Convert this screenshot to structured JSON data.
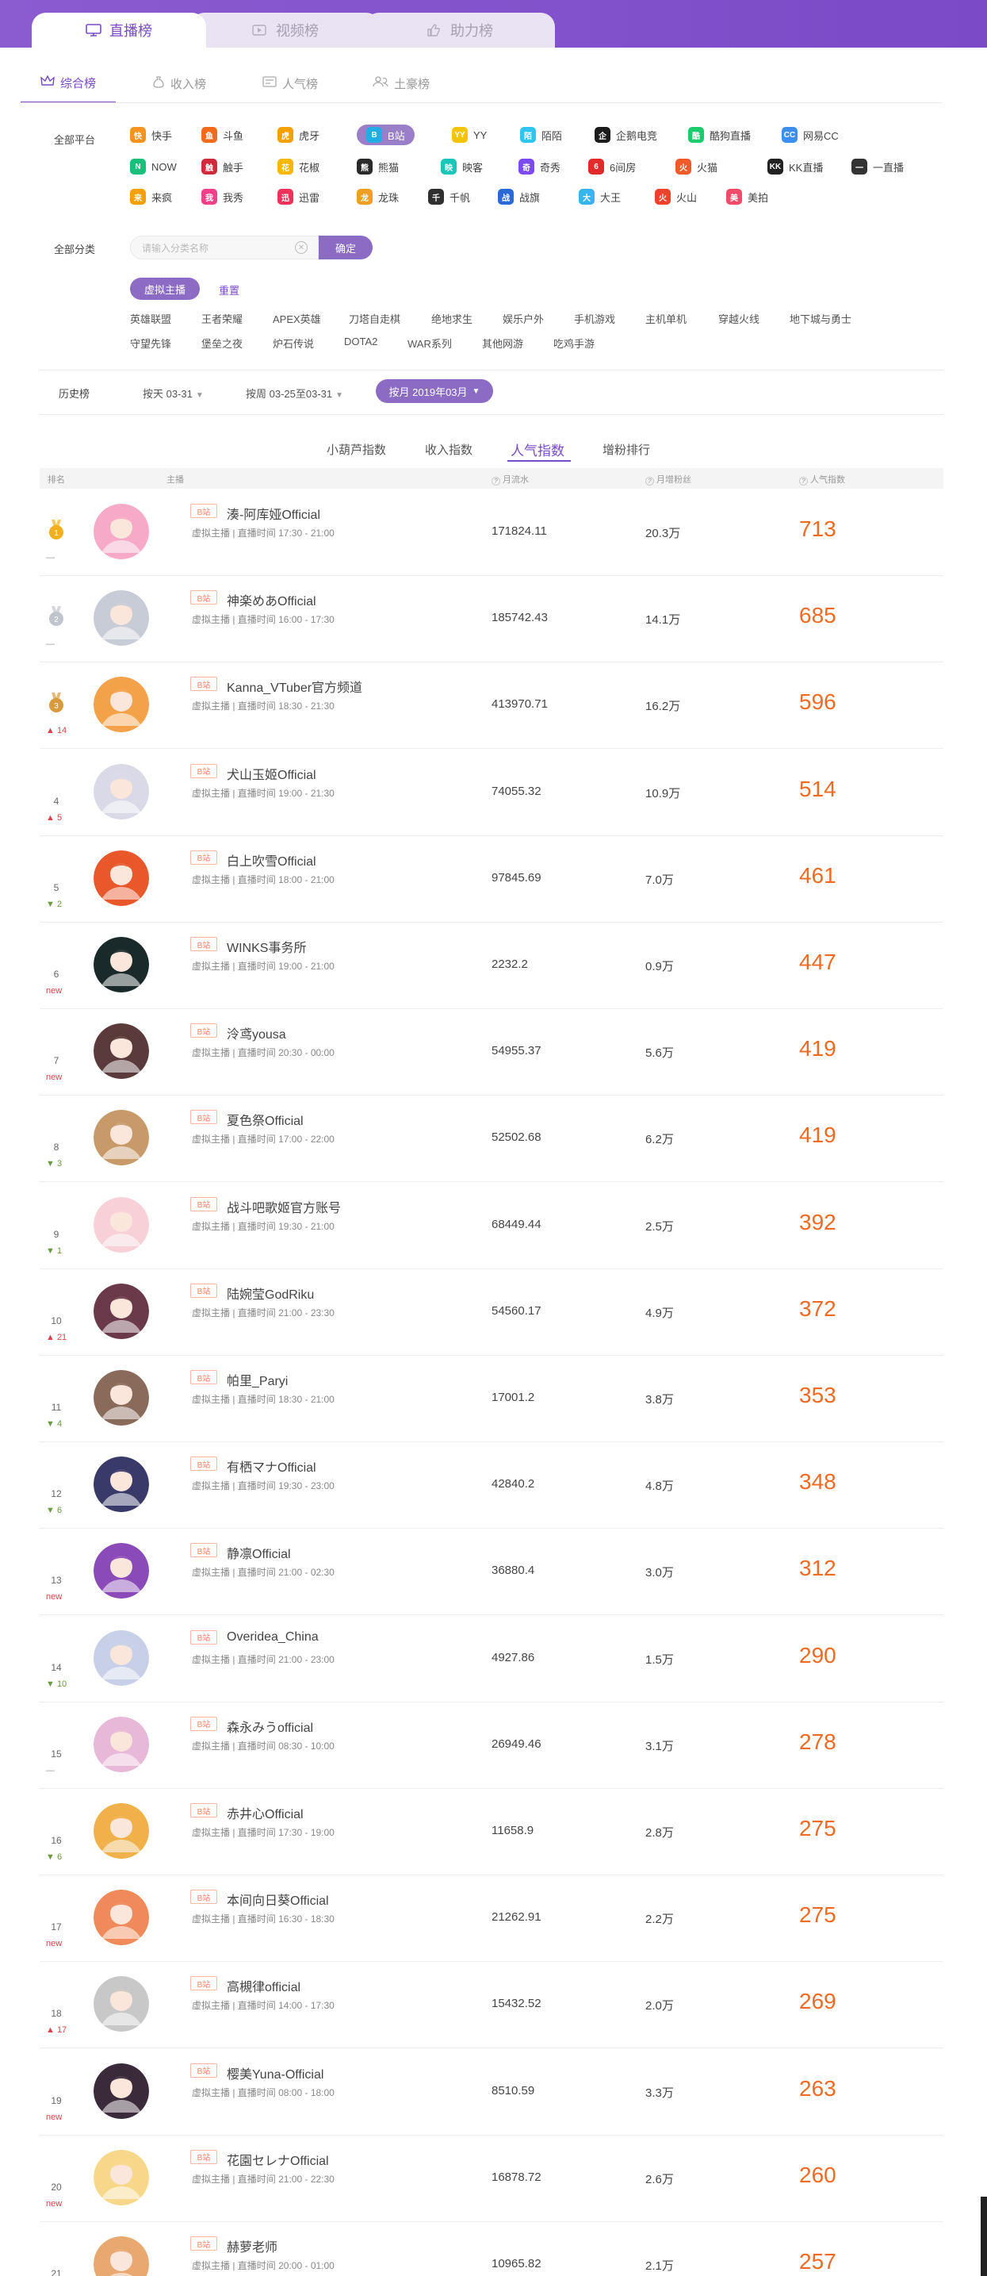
{
  "main_tabs": [
    {
      "label": "直播榜",
      "icon": "monitor-icon"
    },
    {
      "label": "视频榜",
      "icon": "video-icon"
    },
    {
      "label": "助力榜",
      "icon": "thumbs-up-icon"
    }
  ],
  "sub_tabs": [
    {
      "label": "综合榜",
      "icon": "crown-icon"
    },
    {
      "label": "收入榜",
      "icon": "money-bag-icon"
    },
    {
      "label": "人气榜",
      "icon": "card-icon"
    },
    {
      "label": "土豪榜",
      "icon": "users-icon"
    }
  ],
  "platform_filter": {
    "label": "全部平台",
    "items": [
      {
        "label": "快手",
        "color": "#f7931e",
        "glyph": "快"
      },
      {
        "label": "斗鱼",
        "color": "#f26a1b",
        "glyph": "鱼"
      },
      {
        "label": "虎牙",
        "color": "#f6a000",
        "glyph": "虎"
      },
      {
        "label": "B站",
        "color": "#23ade5",
        "glyph": "B",
        "selected": true
      },
      {
        "label": "YY",
        "color": "#f5c400",
        "glyph": "YY"
      },
      {
        "label": "陌陌",
        "color": "#2ec5f0",
        "glyph": "陌"
      },
      {
        "label": "企鹅电竞",
        "color": "#1c1c1c",
        "glyph": "企"
      },
      {
        "label": "酷狗直播",
        "color": "#1ccb6c",
        "glyph": "酷"
      },
      {
        "label": "网易CC",
        "color": "#3c8ef0",
        "glyph": "CC"
      },
      {
        "label": "NOW",
        "color": "#18c07a",
        "glyph": "N"
      },
      {
        "label": "触手",
        "color": "#d02a3c",
        "glyph": "触"
      },
      {
        "label": "花椒",
        "color": "#f9b800",
        "glyph": "花"
      },
      {
        "label": "熊猫",
        "color": "#2a2a2a",
        "glyph": "熊"
      },
      {
        "label": "映客",
        "color": "#19c7b8",
        "glyph": "映"
      },
      {
        "label": "奇秀",
        "color": "#7b4af0",
        "glyph": "奇"
      },
      {
        "label": "6间房",
        "color": "#e22a2a",
        "glyph": "6"
      },
      {
        "label": "火猫",
        "color": "#f05a28",
        "glyph": "火"
      },
      {
        "label": "KK直播",
        "color": "#222222",
        "glyph": "KK"
      },
      {
        "label": "一直播",
        "color": "#333333",
        "glyph": "一"
      },
      {
        "label": "来疯",
        "color": "#f6a000",
        "glyph": "来"
      },
      {
        "label": "我秀",
        "color": "#f43f8a",
        "glyph": "我"
      },
      {
        "label": "迅雷",
        "color": "#f0325a",
        "glyph": "迅"
      },
      {
        "label": "龙珠",
        "color": "#f0a020",
        "glyph": "龙"
      },
      {
        "label": "千帆",
        "color": "#303030",
        "glyph": "千"
      },
      {
        "label": "战旗",
        "color": "#2a6ad8",
        "glyph": "战"
      },
      {
        "label": "大王",
        "color": "#38b4f0",
        "glyph": "大"
      },
      {
        "label": "火山",
        "color": "#f0402a",
        "glyph": "火"
      },
      {
        "label": "美拍",
        "color": "#f24a6a",
        "glyph": "美"
      }
    ]
  },
  "category_filter": {
    "label": "全部分类",
    "placeholder": "请输入分类名称",
    "confirm_label": "确定",
    "selected_chip": "虚拟主播",
    "reset_label": "重置",
    "categories_row1": [
      "英雄联盟",
      "王者荣耀",
      "APEX英雄",
      "刀塔自走棋",
      "绝地求生",
      "娱乐户外",
      "手机游戏",
      "主机单机",
      "穿越火线",
      "地下城与勇士"
    ],
    "categories_row2": [
      "守望先锋",
      "堡垒之夜",
      "炉石传说",
      "DOTA2",
      "WAR系列",
      "其他网游",
      "吃鸡手游"
    ]
  },
  "history": {
    "label": "历史榜",
    "by_day": "按天 03-31",
    "by_week": "按周 03-25至03-31",
    "by_month": "按月 2019年03月"
  },
  "index_tabs": [
    "小葫芦指数",
    "收入指数",
    "人气指数",
    "增粉排行"
  ],
  "table": {
    "headers": {
      "rank": "排名",
      "streamer": "主播",
      "flow": "月流水",
      "fans": "月增粉丝",
      "index": "人气指数"
    },
    "rows": [
      {
        "rank": "1",
        "medal": "gold",
        "change": "—",
        "dir": "same",
        "name": "湊-阿库娅Official",
        "meta": "虚拟主播 | 直播时间 17:30 - 21:00",
        "flow": "171824.11",
        "fans": "20.3万",
        "index": "713",
        "avatar": "#f7a9c8"
      },
      {
        "rank": "2",
        "medal": "silver",
        "change": "—",
        "dir": "same",
        "name": "神楽めあOfficial",
        "meta": "虚拟主播 | 直播时间 16:00 - 17:30",
        "flow": "185742.43",
        "fans": "14.1万",
        "index": "685",
        "avatar": "#c8ccd6"
      },
      {
        "rank": "3",
        "medal": "bronze",
        "change": "▲ 14",
        "dir": "up",
        "name": "Kanna_VTuber官方频道",
        "meta": "虚拟主播 | 直播时间 18:30 - 21:30",
        "flow": "413970.71",
        "fans": "16.2万",
        "index": "596",
        "avatar": "#f3a24a"
      },
      {
        "rank": "4",
        "change": "▲ 5",
        "dir": "up",
        "name": "犬山玉姬Official",
        "meta": "虚拟主播 | 直播时间 19:00 - 21:30",
        "flow": "74055.32",
        "fans": "10.9万",
        "index": "514",
        "avatar": "#d9d9e8"
      },
      {
        "rank": "5",
        "change": "▼ 2",
        "dir": "down",
        "name": "白上吹雪Official",
        "meta": "虚拟主播 | 直播时间 18:00 - 21:00",
        "flow": "97845.69",
        "fans": "7.0万",
        "index": "461",
        "avatar": "#e8582a"
      },
      {
        "rank": "6",
        "change": "new",
        "dir": "new",
        "name": "WINKS事务所",
        "meta": "虚拟主播 | 直播时间 19:00 - 21:00",
        "flow": "2232.2",
        "fans": "0.9万",
        "index": "447",
        "avatar": "#1a2a2a"
      },
      {
        "rank": "7",
        "change": "new",
        "dir": "new",
        "name": "泠鸢yousa",
        "meta": "虚拟主播 | 直播时间 20:30 - 00:00",
        "flow": "54955.37",
        "fans": "5.6万",
        "index": "419",
        "avatar": "#5a3a3a"
      },
      {
        "rank": "8",
        "change": "▼ 3",
        "dir": "down",
        "name": "夏色祭Official",
        "meta": "虚拟主播 | 直播时间 17:00 - 22:00",
        "flow": "52502.68",
        "fans": "6.2万",
        "index": "419",
        "avatar": "#c89a6a"
      },
      {
        "rank": "9",
        "change": "▼ 1",
        "dir": "down",
        "name": "战斗吧歌姬官方账号",
        "meta": "虚拟主播 | 直播时间 19:30 - 21:00",
        "flow": "68449.44",
        "fans": "2.5万",
        "index": "392",
        "avatar": "#f7d0d8"
      },
      {
        "rank": "10",
        "change": "▲ 21",
        "dir": "up",
        "name": "陆婉莹GodRiku",
        "meta": "虚拟主播 | 直播时间 21:00 - 23:30",
        "flow": "54560.17",
        "fans": "4.9万",
        "index": "372",
        "avatar": "#6a3a4a"
      },
      {
        "rank": "11",
        "change": "▼ 4",
        "dir": "down",
        "name": "帕里_Paryi",
        "meta": "虚拟主播 | 直播时间 18:30 - 21:00",
        "flow": "17001.2",
        "fans": "3.8万",
        "index": "353",
        "avatar": "#8a6a5a"
      },
      {
        "rank": "12",
        "change": "▼ 6",
        "dir": "down",
        "name": "有栖マナOfficial",
        "meta": "虚拟主播 | 直播时间 19:30 - 23:00",
        "flow": "42840.2",
        "fans": "4.8万",
        "index": "348",
        "avatar": "#3a3a6a"
      },
      {
        "rank": "13",
        "change": "new",
        "dir": "new",
        "name": "静凛Official",
        "meta": "虚拟主播 | 直播时间 21:00 - 02:30",
        "flow": "36880.4",
        "fans": "3.0万",
        "index": "312",
        "avatar": "#8a4ab8"
      },
      {
        "rank": "14",
        "change": "▼ 10",
        "dir": "down",
        "name": "Overidea_China",
        "meta": "虚拟主播 | 直播时间 21:00 - 23:00",
        "flow": "4927.86",
        "fans": "1.5万",
        "index": "290",
        "avatar": "#c8d0e8"
      },
      {
        "rank": "15",
        "change": "—",
        "dir": "same",
        "name": "森永みうofficial",
        "meta": "虚拟主播 | 直播时间 08:30 - 10:00",
        "flow": "26949.46",
        "fans": "3.1万",
        "index": "278",
        "avatar": "#e8b8d8"
      },
      {
        "rank": "16",
        "change": "▼ 6",
        "dir": "down",
        "name": "赤井心Official",
        "meta": "虚拟主播 | 直播时间 17:30 - 19:00",
        "flow": "11658.9",
        "fans": "2.8万",
        "index": "275",
        "avatar": "#f0b04a"
      },
      {
        "rank": "17",
        "change": "new",
        "dir": "new",
        "name": "本间向日葵Official",
        "meta": "虚拟主播 | 直播时间 16:30 - 18:30",
        "flow": "21262.91",
        "fans": "2.2万",
        "index": "275",
        "avatar": "#f08a5a"
      },
      {
        "rank": "18",
        "change": "▲ 17",
        "dir": "up",
        "name": "高槻律official",
        "meta": "虚拟主播 | 直播时间 14:00 - 17:30",
        "flow": "15432.52",
        "fans": "2.0万",
        "index": "269",
        "avatar": "#c8c8c8"
      },
      {
        "rank": "19",
        "change": "new",
        "dir": "new",
        "name": "樱美Yuna-Official",
        "meta": "虚拟主播 | 直播时间 08:00 - 18:00",
        "flow": "8510.59",
        "fans": "3.3万",
        "index": "263",
        "avatar": "#3a2a3a"
      },
      {
        "rank": "20",
        "change": "new",
        "dir": "new",
        "name": "花園セレナOfficial",
        "meta": "虚拟主播 | 直播时间 21:00 - 22:30",
        "flow": "16878.72",
        "fans": "2.6万",
        "index": "260",
        "avatar": "#f7d88a"
      },
      {
        "rank": "21",
        "change": "",
        "dir": "same",
        "name": "赫萝老师",
        "meta": "虚拟主播 | 直播时间 20:00 - 01:00",
        "flow": "10965.82",
        "fans": "2.1万",
        "index": "257",
        "avatar": "#e8a870"
      }
    ],
    "platform_badge": "B站"
  }
}
